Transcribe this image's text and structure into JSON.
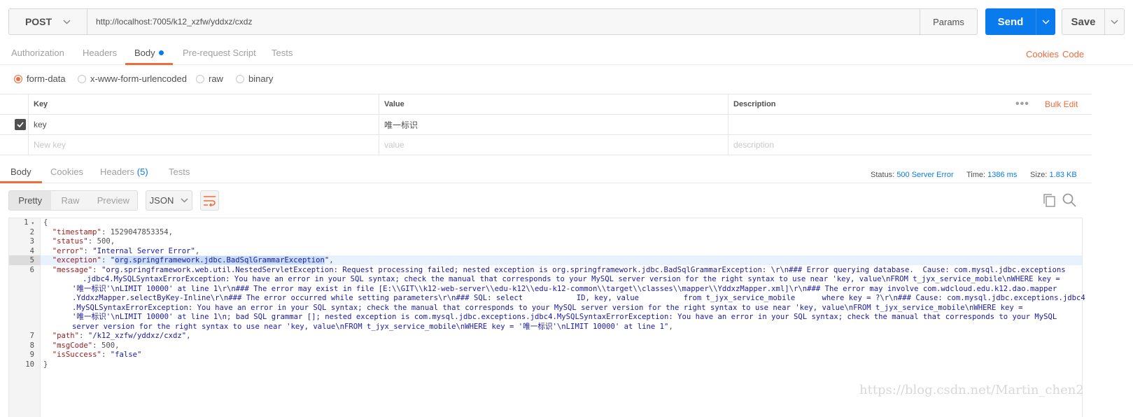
{
  "request": {
    "method": "POST",
    "url": "http://localhost:7005/k12_xzfw/yddxz/cxdz",
    "params_label": "Params",
    "send_label": "Send",
    "save_label": "Save"
  },
  "request_tabs": [
    {
      "label": "Authorization"
    },
    {
      "label": "Headers"
    },
    {
      "label": "Body"
    },
    {
      "label": "Pre-request Script"
    },
    {
      "label": "Tests"
    }
  ],
  "links": {
    "cookies": "Cookies",
    "code": "Code"
  },
  "body_types": [
    "form-data",
    "x-www-form-urlencoded",
    "raw",
    "binary"
  ],
  "kv_table": {
    "headers": {
      "key": "Key",
      "value": "Value",
      "description": "Description",
      "bulk_edit": "Bulk Edit"
    },
    "rows": [
      {
        "key": "key",
        "value": "唯一标识",
        "description": ""
      }
    ],
    "placeholders": {
      "key": "New key",
      "value": "value",
      "description": "description"
    }
  },
  "response_tabs": {
    "body": "Body",
    "cookies": "Cookies",
    "headers": "Headers",
    "headers_count": "(5)",
    "tests": "Tests"
  },
  "status": {
    "status_label": "Status:",
    "status_value": "500 Server Error",
    "time_label": "Time:",
    "time_value": "1386 ms",
    "size_label": "Size:",
    "size_value": "1.83 KB"
  },
  "format_modes": [
    "Pretty",
    "Raw",
    "Preview"
  ],
  "format_lang": "JSON",
  "code": {
    "line_numbers": [
      "1",
      "2",
      "3",
      "4",
      "5",
      "6",
      "7",
      "8",
      "9",
      "10"
    ],
    "l1": "{",
    "ts_key": "\"timestamp\"",
    "ts_val": "1529047853354",
    "status_key": "\"status\"",
    "status_val": "500",
    "error_key": "\"error\"",
    "error_val": "\"Internal Server Error\"",
    "exc_key": "\"exception\"",
    "exc_q1": "\"",
    "exc_sel": "org.springframework.jdbc.BadSqlGrammarException",
    "exc_q2": "\"",
    "msg_key": "\"message\"",
    "msg_1": "\"org.springframework.web.util.NestedServletException: Request processing failed; nested exception is org.springframework.jdbc.BadSqlGrammarException: \\r\\n### Error querying database.  Cause: com.mysql.jdbc.exceptions",
    "msg_2": ".jdbc4.MySQLSyntaxErrorException: You have an error in your SQL syntax; check the manual that corresponds to your MySQL server version for the right syntax to use near 'key, value\\nFROM t_jyx_service_mobile\\nWHERE key =",
    "msg_3": "'唯一标识'\\nLIMIT 10000' at line 1\\r\\n### The error may exist in file [E:\\\\GIT\\\\k12-web-server\\\\edu-k12\\\\edu-k12-common\\\\target\\\\classes\\\\mapper\\\\YddxzMapper.xml]\\r\\n### The error may involve com.wdcloud.edu.k12.dao.mapper",
    "msg_4": ".YddxzMapper.selectByKey-Inline\\r\\n### The error occurred while setting parameters\\r\\n### SQL: select            ID, key, value          from t_jyx_service_mobile      where key = ?\\r\\n### Cause: com.mysql.jdbc.exceptions.jdbc4",
    "msg_5": ".MySQLSyntaxErrorException: You have an error in your SQL syntax; check the manual that corresponds to your MySQL server version for the right syntax to use near 'key, value\\nFROM t_jyx_service_mobile\\nWHERE key =",
    "msg_6": "'唯一标识'\\nLIMIT 10000' at line 1\\n; bad SQL grammar []; nested exception is com.mysql.jdbc.exceptions.jdbc4.MySQLSyntaxErrorException: You have an error in your SQL syntax; check the manual that corresponds to your MySQL",
    "msg_7": "server version for the right syntax to use near 'key, value\\nFROM t_jyx_service_mobile\\nWHERE key = '唯一标识'\\nLIMIT 10000' at line 1\"",
    "path_key": "\"path\"",
    "path_val": "\"/k12_xzfw/yddxz/cxdz\"",
    "msgcode_key": "\"msgCode\"",
    "msgcode_val": "500",
    "success_key": "\"isSuccess\"",
    "success_val": "\"false\"",
    "l10": "}"
  },
  "watermark": "https://blog.csdn.net/Martin_chen2",
  "colors": {
    "accent": "#f26b3a",
    "primary": "#097bed"
  }
}
